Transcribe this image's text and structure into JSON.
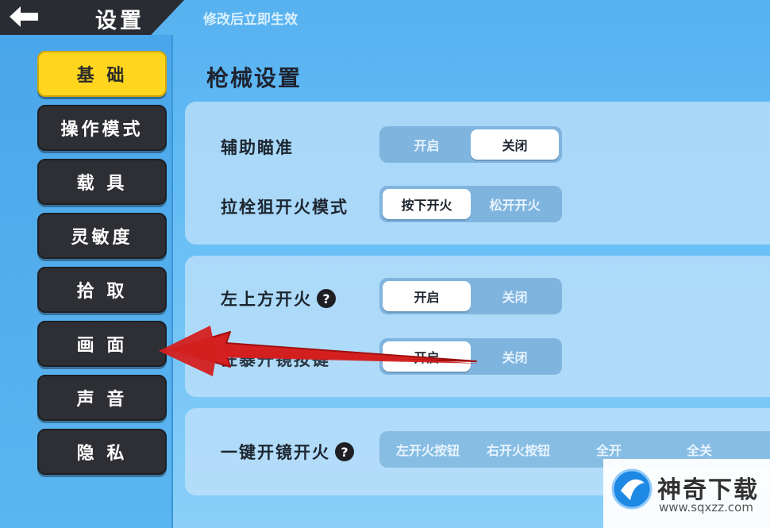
{
  "header": {
    "title": "设置",
    "notice": "修改后立即生效"
  },
  "sidebar": {
    "items": [
      {
        "label": "基 础",
        "active": true
      },
      {
        "label": "操作模式",
        "active": false
      },
      {
        "label": "载 具",
        "active": false
      },
      {
        "label": "灵敏度",
        "active": false
      },
      {
        "label": "拾 取",
        "active": false
      },
      {
        "label": "画 面",
        "active": false
      },
      {
        "label": "声 音",
        "active": false
      },
      {
        "label": "隐 私",
        "active": false
      }
    ]
  },
  "main": {
    "section_title": "枪械设置",
    "rows": [
      {
        "label": "辅助瞄准",
        "options": [
          "开启",
          "关闭"
        ],
        "selected": 1,
        "help": false
      },
      {
        "label": "拉栓狙开火模式",
        "options": [
          "按下开火",
          "松开开火"
        ],
        "selected": 0,
        "help": false
      },
      {
        "label": "左上方开火",
        "options": [
          "开启",
          "关闭"
        ],
        "selected": 0,
        "help": true
      },
      {
        "label": "狂暴开镜按键",
        "options": [
          "开启",
          "关闭"
        ],
        "selected": 0,
        "help": false
      },
      {
        "label": "一键开镜开火",
        "options": [
          "左开火按钮",
          "右开火按钮",
          "全开",
          "全关"
        ],
        "selected": -1,
        "help": true
      }
    ]
  },
  "watermark": {
    "title": "神奇下载",
    "url": "www.sqxzz.com"
  },
  "colors": {
    "accent_yellow": "#ffd51e",
    "nav_dark": "#2d2f34",
    "arrow_red": "#d42020",
    "background_blue": "#66bdf5"
  }
}
